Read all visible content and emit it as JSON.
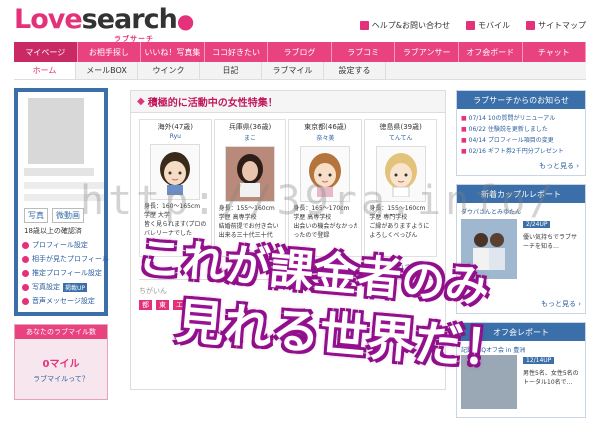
{
  "header": {
    "logo_love": "Love",
    "logo_search": "search",
    "logo_sub": "ラブサーチ",
    "links": [
      "ヘルプ&お問い合わせ",
      "モバイル",
      "サイトマップ"
    ]
  },
  "nav": {
    "items": [
      "マイページ",
      "お相手探し",
      "いいね！写真集",
      "ココ好きたい",
      "ラブログ",
      "ラブコミ",
      "ラブアンサー",
      "オフ会ボード",
      "チャット"
    ],
    "active_index": 0
  },
  "subnav": {
    "items": [
      "ホーム",
      "メールBOX",
      "ウインク",
      "日記",
      "ラブマイル",
      "設定する"
    ],
    "active_index": 0
  },
  "left": {
    "photo_tabs": [
      "写真",
      "微動画"
    ],
    "age_line": "18歳以上の確認済",
    "menu": [
      "プロフィール設定",
      "相手が見たプロフィール",
      "推定プロフィール設定",
      "写真設定",
      "音声メッセージ設定"
    ],
    "badge": "掲載UP",
    "lovemile_head": "あなたのラブマイル数",
    "lovemile_value": "0マイル",
    "lovemile_link": "ラブマイルって？"
  },
  "center": {
    "title": "積極的に活動中の女性特集！",
    "cards": [
      {
        "loc": "海外(47歳)",
        "name": "Ryu",
        "info": [
          "身長：160～165cm",
          "学歴 大学",
          "皆く見られます(プロの",
          "バレリーナでした"
        ]
      },
      {
        "loc": "兵庫県(36歳)",
        "name": "まこ",
        "info": [
          "身長：155～160cm",
          "学歴 高専学校",
          "結婚前提でお付き合い",
          "出来る三十代三十代"
        ]
      },
      {
        "loc": "東京都(46歳)",
        "name": "奈々美",
        "info": [
          "身長：165～170cm",
          "学歴 高専学校",
          "出会いの機会がなかった",
          "ったので登録"
        ]
      },
      {
        "loc": "徳島県(39歳)",
        "name": "てんてん",
        "info": [
          "身長：155～160cm",
          "学歴 専門学校",
          "ご縁がありますように",
          "よろしくべっぴん"
        ]
      }
    ],
    "more": "もっと見る ›",
    "sub_text": "ちがいん",
    "sub_tabs": [
      "都",
      "東",
      "エロ"
    ]
  },
  "right": {
    "news_head": "ラブサーチからのお知らせ",
    "news": [
      "07/14 10の質問がリニューアル",
      "06/22 住験説を更新しました",
      "04/14 プロフィール項目の変更",
      "02/16 ギフト券2千円分プレゼント"
    ],
    "more": "もっと見る ›",
    "couple_head": "新着カップルレポート",
    "couple_names": "ダウパさんとみゆたん",
    "couple_date": "2/24UP",
    "couple_text": "優い気持ちでラブサーチを知る…",
    "off_head": "オフ会レポート",
    "off_title": "記録BBQオフ会 in 豊洲",
    "off_date": "12/14UP",
    "off_text": "男性5名、女性5名のトータル10名で…"
  },
  "watermark": "http://39ra.info/",
  "overlay": {
    "line1": "これが課金者のみ",
    "line2": "見れる世界だ！"
  },
  "colors": {
    "brand": "#e3317a",
    "nav": "#e8427f",
    "blue": "#3b6fa9"
  }
}
